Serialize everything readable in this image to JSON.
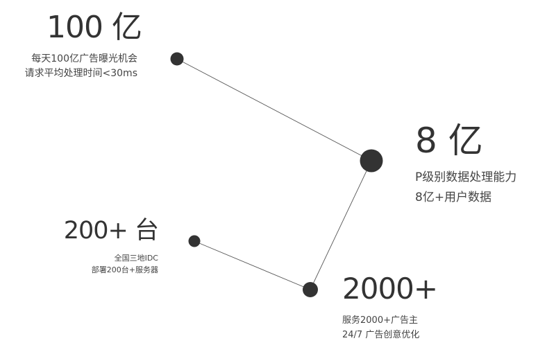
{
  "nodes": [
    {
      "id": "100yi",
      "headline": "100 亿",
      "lines": [
        "每天100亿广告曝光机会",
        "请求平均处理时间<30ms"
      ]
    },
    {
      "id": "8yi",
      "headline": "8 亿",
      "lines": [
        "P级别数据处理能力",
        "8亿+用户数据"
      ]
    },
    {
      "id": "2000plus",
      "headline": "2000+",
      "lines": [
        "服务2000+广告主",
        "24/7 广告创意优化"
      ]
    },
    {
      "id": "200tai",
      "headline": "200+ 台",
      "lines": [
        "全国三地IDC",
        "部署200台+服务器"
      ]
    }
  ],
  "colors": {
    "node": "#333333",
    "edge": "#555555",
    "text": "#333333"
  }
}
